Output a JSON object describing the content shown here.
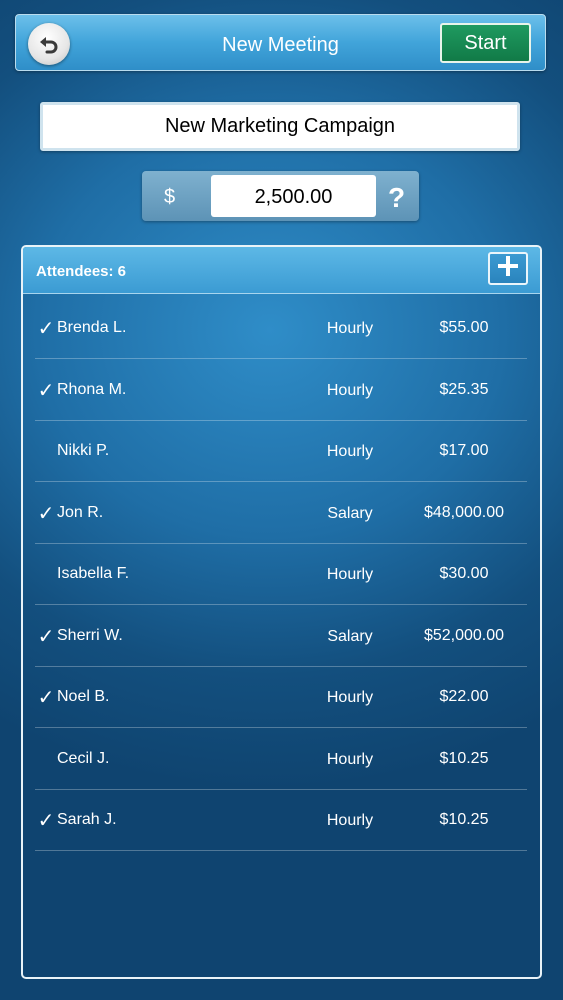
{
  "header": {
    "title": "New Meeting",
    "start_label": "Start",
    "back_icon": "undo-arrow-icon"
  },
  "meeting": {
    "name": "New Marketing Campaign"
  },
  "budget": {
    "currency": "$",
    "amount": "2,500.00",
    "help_label": "?"
  },
  "attendees": {
    "label": "Attendees: 6",
    "add_icon": "plus-icon",
    "check_glyph": "✓",
    "rows": [
      {
        "checked": true,
        "name": "Brenda L.",
        "type": "Hourly",
        "rate": "$55.00"
      },
      {
        "checked": true,
        "name": "Rhona M.",
        "type": "Hourly",
        "rate": "$25.35"
      },
      {
        "checked": false,
        "name": "Nikki P.",
        "type": "Hourly",
        "rate": "$17.00"
      },
      {
        "checked": true,
        "name": "Jon R.",
        "type": "Salary",
        "rate": "$48,000.00"
      },
      {
        "checked": false,
        "name": "Isabella F.",
        "type": "Hourly",
        "rate": "$30.00"
      },
      {
        "checked": true,
        "name": "Sherri W.",
        "type": "Salary",
        "rate": "$52,000.00"
      },
      {
        "checked": true,
        "name": "Noel B.",
        "type": "Hourly",
        "rate": "$22.00"
      },
      {
        "checked": false,
        "name": "Cecil J.",
        "type": "Hourly",
        "rate": "$10.25"
      },
      {
        "checked": true,
        "name": "Sarah J.",
        "type": "Hourly",
        "rate": "$10.25"
      }
    ]
  },
  "colors": {
    "start_button": "#117a47",
    "header_bar": "#41a4da",
    "background": "#1f6ea6"
  }
}
